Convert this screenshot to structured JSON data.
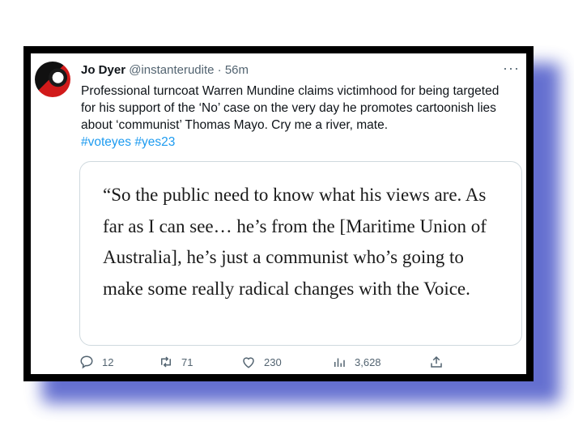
{
  "tweet": {
    "author_name": "Jo Dyer",
    "author_handle": "@instanterudite",
    "separator": "·",
    "time": "56m",
    "more": "···",
    "text": "Professional turncoat Warren Mundine claims victimhood for being targeted for his support of the ‘No’ case on the very day he promotes cartoonish lies about ‘communist’ Thomas Mayo.  Cry me a river, mate.",
    "hashtags": [
      "#voteyes",
      "#yes23"
    ],
    "quote": "“So the public need to know what his views are. As far as I can see… he’s from the [Maritime Union of Australia], he’s just a communist who’s going to make some really radical changes with the Voice."
  },
  "actions": {
    "replies": "12",
    "retweets": "71",
    "likes": "230",
    "views": "3,628"
  },
  "icons": [
    "reply-icon",
    "retweet-icon",
    "like-icon",
    "views-icon",
    "share-icon"
  ],
  "colors": {
    "shadow": "#4a57c8",
    "link": "#1d9bf0",
    "muted": "#536471"
  }
}
